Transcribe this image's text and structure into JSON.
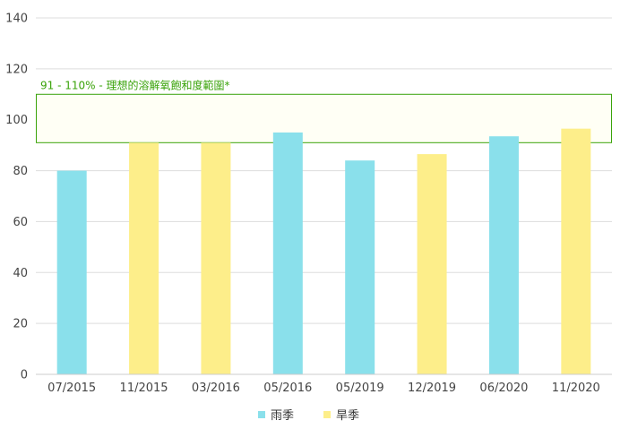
{
  "chart_data": {
    "type": "bar",
    "categories": [
      "07/2015",
      "11/2015",
      "03/2016",
      "05/2016",
      "05/2019",
      "12/2019",
      "06/2020",
      "11/2020"
    ],
    "values": [
      80,
      91,
      91,
      95,
      84,
      86.5,
      93.5,
      96.5
    ],
    "season": [
      "雨季",
      "旱季",
      "旱季",
      "雨季",
      "雨季",
      "旱季",
      "雨季",
      "旱季"
    ],
    "series": [
      {
        "name": "雨季",
        "color": "#8ae0eb"
      },
      {
        "name": "旱季",
        "color": "#fdee8a"
      }
    ],
    "ylim": [
      0,
      140
    ],
    "yticks": [
      0,
      20,
      40,
      60,
      80,
      100,
      120,
      140
    ],
    "grid": true,
    "legend": "bottom-center",
    "band": {
      "from": 91,
      "to": 110,
      "label": "91 - 110% - 理想的溶解氧飽和度範圍*",
      "color": "#3aa30a",
      "fill": "#fffff5"
    }
  }
}
